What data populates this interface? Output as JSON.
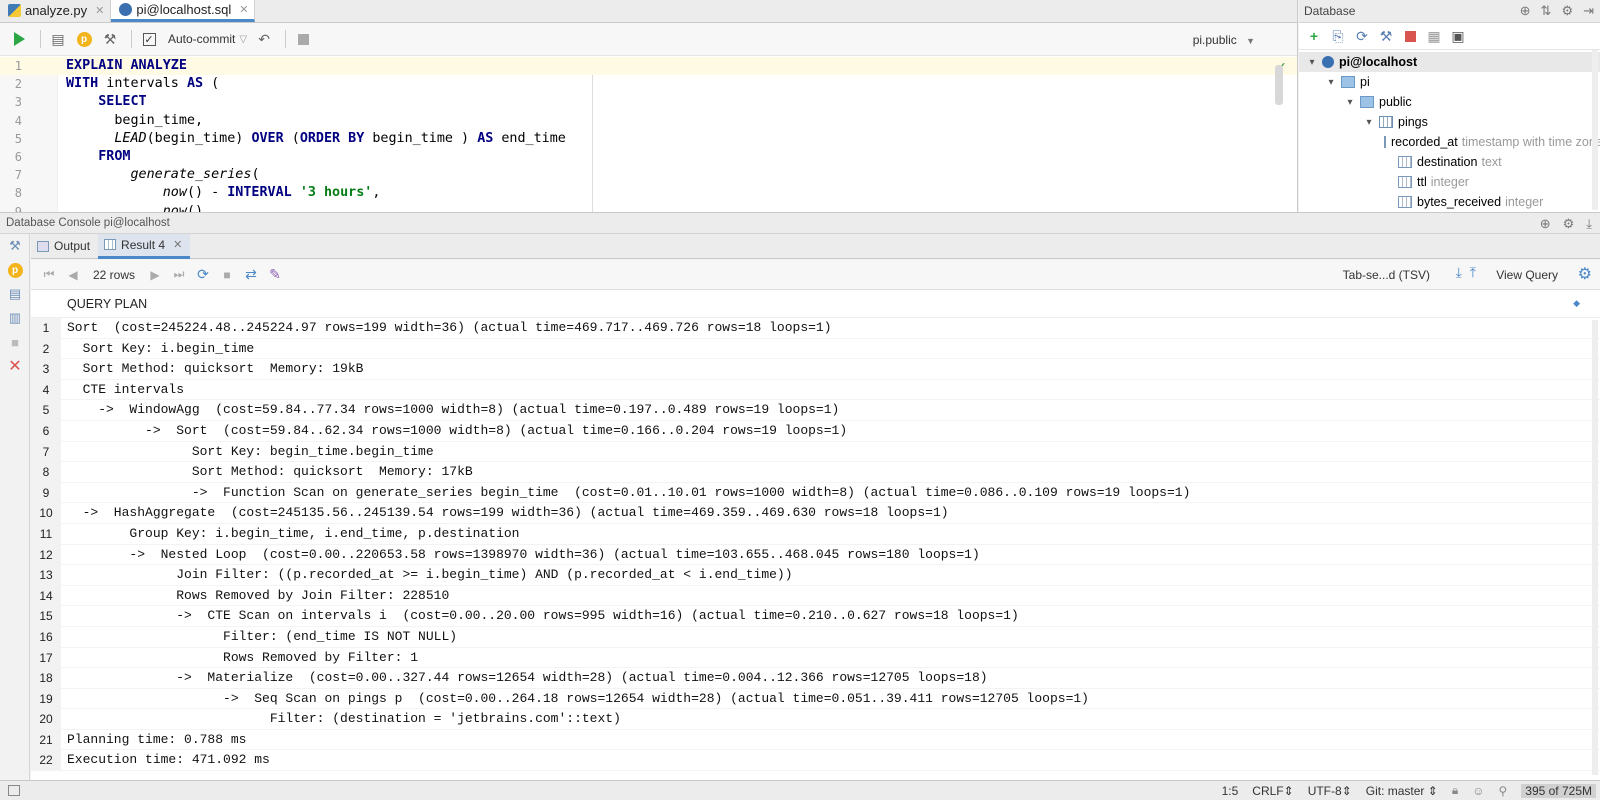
{
  "editor": {
    "tabs": [
      {
        "label": "analyze.py",
        "icon": "python-file-icon"
      },
      {
        "label": "pi@localhost.sql",
        "icon": "postgres-file-icon"
      }
    ],
    "autocommit_label": "Auto-commit",
    "schema": "pi.public",
    "lines": [
      {
        "n": "1",
        "html": "<span class='kw'>EXPLAIN ANALYZE</span>"
      },
      {
        "n": "2",
        "html": "<span class='kw'>WITH</span> intervals <span class='kw'>AS</span> ("
      },
      {
        "n": "3",
        "html": "    <span class='kw'>SELECT</span>"
      },
      {
        "n": "4",
        "html": "      begin_time,"
      },
      {
        "n": "5",
        "html": "      <span class='fn'>LEAD</span>(begin_time) <span class='kw'>OVER</span> (<span class='kw'>ORDER BY</span> begin_time ) <span class='kw'>AS</span> end_time"
      },
      {
        "n": "6",
        "html": "    <span class='kw'>FROM</span>"
      },
      {
        "n": "7",
        "html": "        <span class='fn'>generate_series</span>("
      },
      {
        "n": "8",
        "html": "            <span class='fn'>now</span>() - <span class='kw'>INTERVAL</span> <span class='str'>'3 hours'</span>,"
      },
      {
        "n": "9",
        "html": "            <span class='fn'>now</span>()"
      }
    ]
  },
  "database_panel": {
    "title": "Database",
    "tree": [
      {
        "label": "pi@localhost",
        "type": "",
        "level": 0,
        "arrow": "▾",
        "icon": "ic-db",
        "bold": true,
        "selected": true
      },
      {
        "label": "pi",
        "type": "",
        "level": 1,
        "arrow": "▾",
        "icon": "ic-schema"
      },
      {
        "label": "public",
        "type": "",
        "level": 2,
        "arrow": "▾",
        "icon": "ic-schema"
      },
      {
        "label": "pings",
        "type": "",
        "level": 3,
        "arrow": "▾",
        "icon": "ic-table"
      },
      {
        "label": "recorded_at",
        "type": "timestamp with time zone",
        "level": 4,
        "arrow": "",
        "icon": "ic-col"
      },
      {
        "label": "destination",
        "type": "text",
        "level": 4,
        "arrow": "",
        "icon": "ic-col"
      },
      {
        "label": "ttl",
        "type": "integer",
        "level": 4,
        "arrow": "",
        "icon": "ic-col"
      },
      {
        "label": "bytes_received",
        "type": "integer",
        "level": 4,
        "arrow": "",
        "icon": "ic-col"
      }
    ]
  },
  "console": {
    "title": "Database Console pi@localhost",
    "tabs": [
      {
        "label": "Output",
        "active": false
      },
      {
        "label": "Result 4",
        "active": true
      }
    ],
    "rows_count": "22 rows",
    "export_format": "Tab-se...d (TSV)",
    "view_query": "View Query",
    "column_header": "QUERY PLAN",
    "rows": [
      "Sort  (cost=245224.48..245224.97 rows=199 width=36) (actual time=469.717..469.726 rows=18 loops=1)",
      "  Sort Key: i.begin_time",
      "  Sort Method: quicksort  Memory: 19kB",
      "  CTE intervals",
      "    ->  WindowAgg  (cost=59.84..77.34 rows=1000 width=8) (actual time=0.197..0.489 rows=19 loops=1)",
      "          ->  Sort  (cost=59.84..62.34 rows=1000 width=8) (actual time=0.166..0.204 rows=19 loops=1)",
      "                Sort Key: begin_time.begin_time",
      "                Sort Method: quicksort  Memory: 17kB",
      "                ->  Function Scan on generate_series begin_time  (cost=0.01..10.01 rows=1000 width=8) (actual time=0.086..0.109 rows=19 loops=1)",
      "  ->  HashAggregate  (cost=245135.56..245139.54 rows=199 width=36) (actual time=469.359..469.630 rows=18 loops=1)",
      "        Group Key: i.begin_time, i.end_time, p.destination",
      "        ->  Nested Loop  (cost=0.00..220653.58 rows=1398970 width=36) (actual time=103.655..468.045 rows=180 loops=1)",
      "              Join Filter: ((p.recorded_at >= i.begin_time) AND (p.recorded_at < i.end_time))",
      "              Rows Removed by Join Filter: 228510",
      "              ->  CTE Scan on intervals i  (cost=0.00..20.00 rows=995 width=16) (actual time=0.210..0.627 rows=18 loops=1)",
      "                    Filter: (end_time IS NOT NULL)",
      "                    Rows Removed by Filter: 1",
      "              ->  Materialize  (cost=0.00..327.44 rows=12654 width=28) (actual time=0.004..12.366 rows=12705 loops=18)",
      "                    ->  Seq Scan on pings p  (cost=0.00..264.18 rows=12654 width=28) (actual time=0.051..39.411 rows=12705 loops=1)",
      "                          Filter: (destination = 'jetbrains.com'::text)",
      "Planning time: 0.788 ms",
      "Execution time: 471.092 ms"
    ]
  },
  "status_bar": {
    "position": "1:5",
    "line_sep": "CRLF",
    "encoding": "UTF-8",
    "vcs": "Git: master",
    "memory": "395 of 725M"
  },
  "colors": {
    "accent": "#4a88c7",
    "keyword": "#000080",
    "string": "#067d17",
    "run": "#2da745",
    "stop": "#d9534f"
  }
}
